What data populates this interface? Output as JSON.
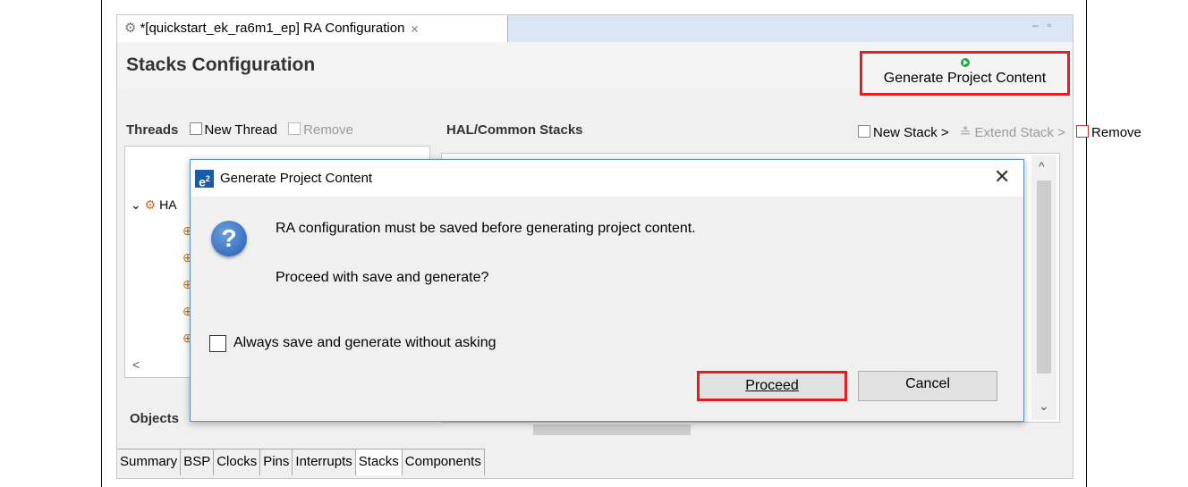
{
  "editor": {
    "tab_title": "*[quickstart_ek_ra6m1_ep] RA Configuration",
    "tab_close": "⨯",
    "page_title": "Stacks Configuration",
    "generate_button": "Generate Project Content"
  },
  "threads": {
    "heading": "Threads",
    "new_thread": "New Thread",
    "remove": "Remove",
    "tree_root": "HA"
  },
  "hal": {
    "heading": "HAL/Common Stacks",
    "new_stack": "New Stack >",
    "extend_stack": "Extend Stack >",
    "remove": "Remove"
  },
  "objects": {
    "heading": "Objects"
  },
  "bottom_tabs": [
    "Summary",
    "BSP",
    "Clocks",
    "Pins",
    "Interrupts",
    "Stacks",
    "Components"
  ],
  "dialog": {
    "title": "Generate Project Content",
    "message": "RA configuration must be saved before generating project content.",
    "question": "Proceed with save and generate?",
    "checkbox_label": "Always save and generate without asking",
    "checkbox_checked": false,
    "proceed": "Proceed",
    "cancel": "Cancel"
  },
  "colors": {
    "highlight": "#e02020",
    "dialog_border": "#5a8fd0",
    "play_icon": "#28a745"
  }
}
